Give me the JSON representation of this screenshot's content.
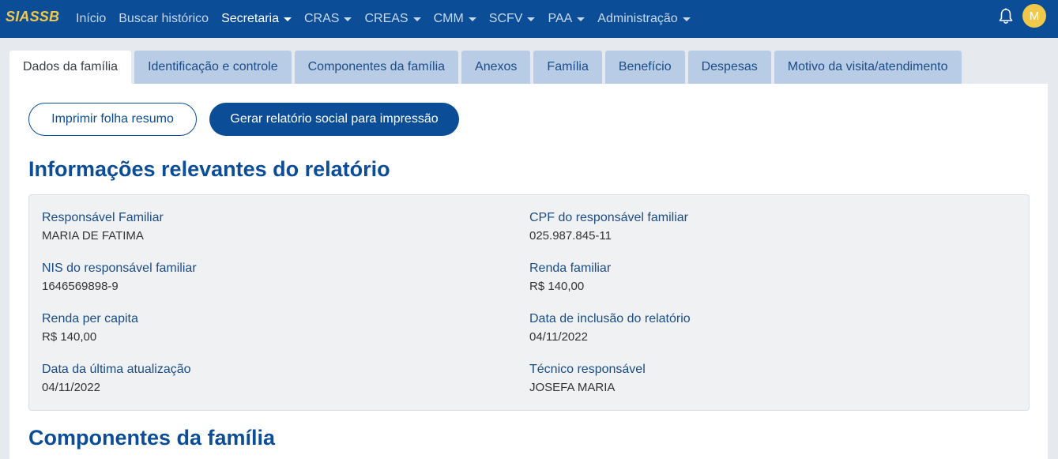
{
  "navbar": {
    "brand": "SIASSB",
    "items": [
      {
        "label": "Início",
        "dropdown": false,
        "active": false
      },
      {
        "label": "Buscar histórico",
        "dropdown": false,
        "active": false
      },
      {
        "label": "Secretaria",
        "dropdown": true,
        "active": true
      },
      {
        "label": "CRAS",
        "dropdown": true,
        "active": false
      },
      {
        "label": "CREAS",
        "dropdown": true,
        "active": false
      },
      {
        "label": "CMM",
        "dropdown": true,
        "active": false
      },
      {
        "label": "SCFV",
        "dropdown": true,
        "active": false
      },
      {
        "label": "PAA",
        "dropdown": true,
        "active": false
      },
      {
        "label": "Administração",
        "dropdown": true,
        "active": false
      }
    ],
    "avatar_initial": "M",
    "icons": {
      "notifications": "bell-icon"
    }
  },
  "tabs": [
    {
      "label": "Dados da família",
      "active": true
    },
    {
      "label": "Identificação e controle",
      "active": false
    },
    {
      "label": "Componentes da família",
      "active": false
    },
    {
      "label": "Anexos",
      "active": false
    },
    {
      "label": "Família",
      "active": false
    },
    {
      "label": "Benefício",
      "active": false
    },
    {
      "label": "Despesas",
      "active": false
    },
    {
      "label": "Motivo da visita/atendimento",
      "active": false
    }
  ],
  "actions": {
    "print_summary": "Imprimir folha resumo",
    "generate_report": "Gerar relatório social para impressão"
  },
  "report": {
    "title": "Informações relevantes do relatório",
    "fields": {
      "responsavel": {
        "label": "Responsável Familiar",
        "value": "MARIA DE FATIMA"
      },
      "cpf": {
        "label": "CPF do responsável familiar",
        "value": "025.987.845-11"
      },
      "nis": {
        "label": "NIS do responsável familiar",
        "value": "1646569898-9"
      },
      "renda_familiar": {
        "label": "Renda familiar",
        "value": "R$ 140,00"
      },
      "renda_per_capita": {
        "label": "Renda per capita",
        "value": "R$ 140,00"
      },
      "data_inclusao": {
        "label": "Data de inclusão do relatório",
        "value": "04/11/2022"
      },
      "data_atualizacao": {
        "label": "Data da última atualização",
        "value": "04/11/2022"
      },
      "tecnico": {
        "label": "Técnico responsável",
        "value": "JOSEFA MARIA"
      }
    }
  },
  "components_section": {
    "title": "Componentes da família"
  },
  "colors": {
    "navbar": "#0b4d96",
    "brand": "#f1c94a",
    "tab_inactive": "#b9cce6",
    "accent": "#0b4d96"
  }
}
